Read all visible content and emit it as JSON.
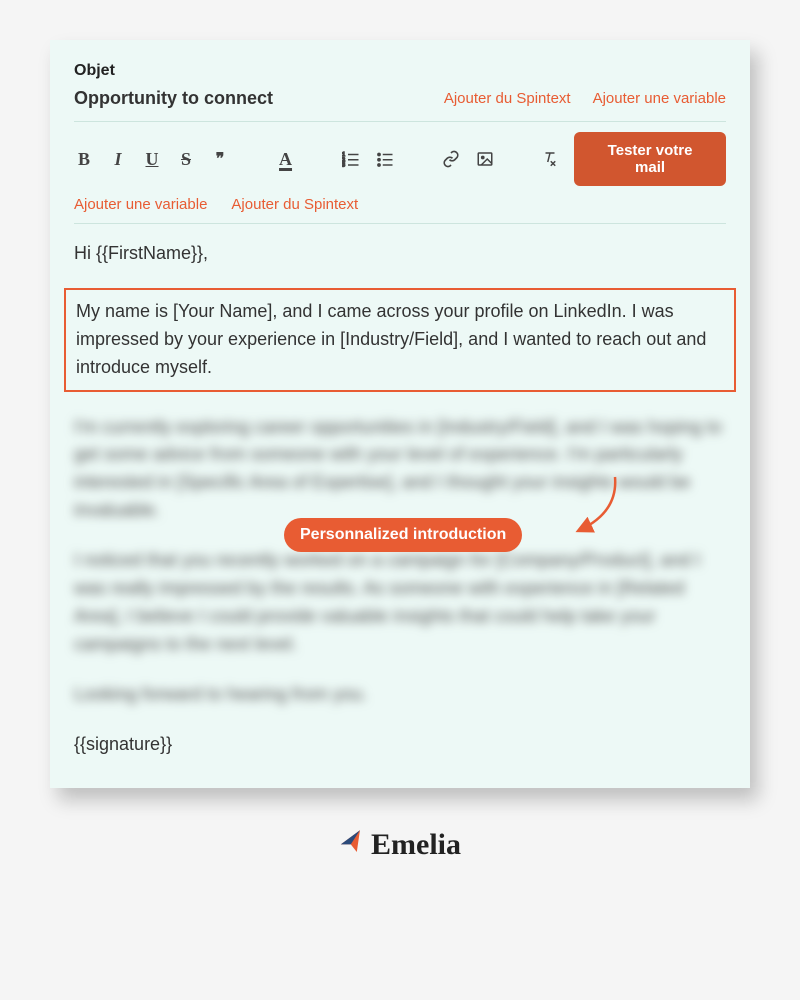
{
  "header": {
    "objet_label": "Objet",
    "subject": "Opportunity to connect",
    "add_spintext": "Ajouter du Spintext",
    "add_variable": "Ajouter une variable",
    "test_button": "Tester votre mail"
  },
  "toolbar_secondary": {
    "add_variable": "Ajouter une variable",
    "add_spintext": "Ajouter du Spintext"
  },
  "body": {
    "greeting": "Hi {{FirstName}},",
    "intro": "My name is [Your Name], and I came across your profile on LinkedIn. I was impressed by your experience in [Industry/Field], and I wanted to reach out and introduce myself.",
    "para2": "I'm currently exploring career opportunities in [Industry/Field], and I was hoping to get some advice from someone with your level of experience. I'm particularly interested in [Specific Area of Expertise], and I thought your insights would be invaluable.",
    "para3": "I noticed that you recently worked on a campaign for [Company/Product], and I was really impressed by the results. As someone with experience in [Related Area], I believe I could provide valuable insights that could help take your campaigns to the next level.",
    "para4": "Looking forward to hearing from you.",
    "signature": "{{signature}}"
  },
  "callout": {
    "text": "Personnalized introduction"
  },
  "brand": {
    "name": "Emelia"
  },
  "icons": {
    "bold": "B",
    "italic": "I",
    "underline": "U",
    "strike": "S",
    "quote": "❞",
    "font_color": "A"
  }
}
